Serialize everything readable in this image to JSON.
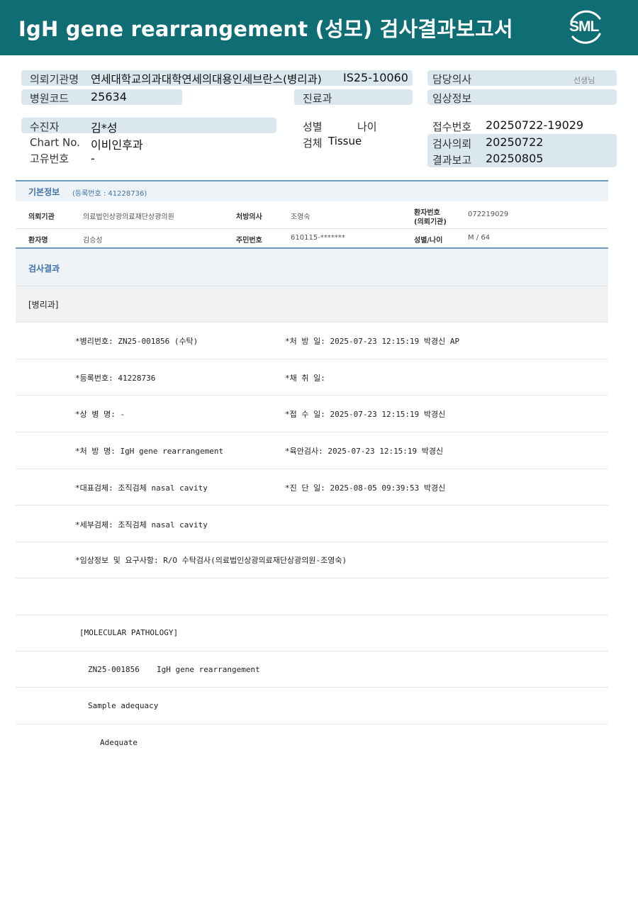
{
  "header": {
    "title": "IgH gene rearrangement (성모) 검사결과보고서",
    "logo_text": "SML"
  },
  "top": {
    "institution_label": "의뢰기관명",
    "institution_value": "연세대학교의과대학연세의대용인세브란스(병리과)",
    "lab_no": "IS25-10060",
    "hospital_code_label": "병원코드",
    "hospital_code_value": "25634",
    "department_label": "진료과",
    "doctor_label": "담당의사",
    "doctor_suffix": "선생님",
    "clinical_label": "임상정보",
    "patient_label": "수진자",
    "patient_value": "김*성",
    "chart_label": "Chart No.",
    "chart_value": "이비인후과",
    "unique_label": "고유번호",
    "unique_value": "-",
    "sex_label": "성별",
    "age_label": "나이",
    "specimen_label": "검체",
    "specimen_value": "Tissue",
    "receipt_label": "접수번호",
    "receipt_value": "20250722-19029",
    "request_label": "검사의뢰",
    "request_value": "20250722",
    "report_label": "결과보고",
    "report_value": "20250805"
  },
  "basic": {
    "title": "기본정보",
    "reg_no": "(등록번호 : 41228736)",
    "row1": {
      "k1": "의뢰기관",
      "v1": "의료법인상광의료재단상광의원",
      "k2": "처방의사",
      "v2": "조영숙",
      "k3a": "환자번호",
      "k3b": "(의뢰기관)",
      "v3": "072219029"
    },
    "row2": {
      "k1": "환자명",
      "v1": "김승성",
      "k2": "주민번호",
      "v2": "610115-*******",
      "k3": "성별/나이",
      "v3": "M / 64"
    }
  },
  "result": {
    "title": "검사결과",
    "dept": "[병리과]",
    "lines": [
      {
        "left": "*병리번호: ZN25-001856 (수탁)",
        "right": "*처 방 일: 2025-07-23 12:15:19  박경신 AP"
      },
      {
        "left": "*등록번호: 41228736",
        "right": "*채 취 일:"
      },
      {
        "left": "*상 병 명: -",
        "right": "*접 수 일: 2025-07-23 12:15:19  박경신"
      },
      {
        "left": "*처 방 명: IgH gene rearrangement",
        "right": "*육안검사: 2025-07-23 12:15:19  박경신"
      },
      {
        "left": "*대표검체: 조직검체 nasal cavity",
        "right": "*진 단 일: 2025-08-05 09:39:53  박경신"
      },
      {
        "left": "*세부검체: 조직검체 nasal cavity",
        "right": ""
      },
      {
        "left": "*임상정보 및 요구사항: R/O 수탁검사(의료법인상광의료재단상광의원-조영숙)",
        "right": ""
      }
    ],
    "molecular_header": "[MOLECULAR PATHOLOGY]",
    "case_id": "ZN25-001856",
    "case_test": "IgH gene rearrangement",
    "adequacy_label": "Sample adequacy",
    "adequacy_value": "Adequate"
  }
}
